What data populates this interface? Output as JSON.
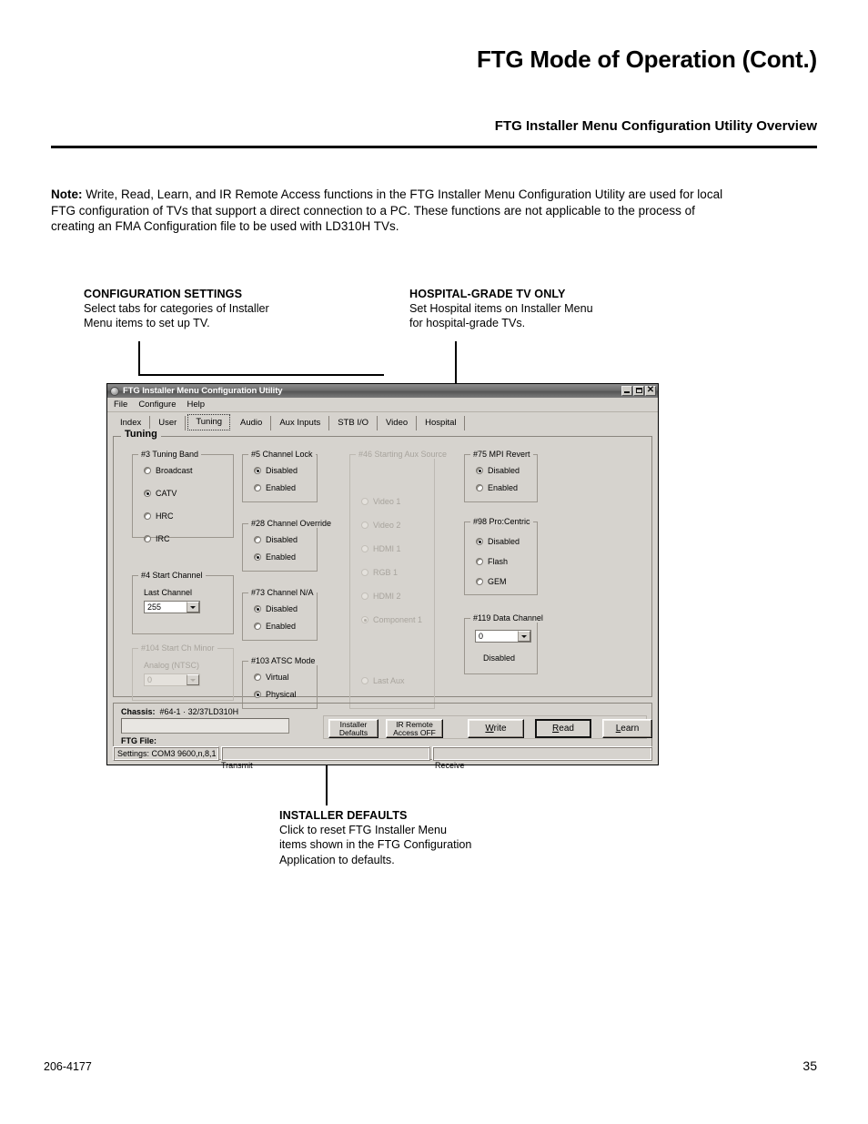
{
  "page": {
    "title": "FTG Mode of Operation (Cont.)",
    "subtitle": "FTG Installer Menu Configuration Utility Overview",
    "note_label": "Note:",
    "note_text": " Write, Read, Learn, and IR Remote Access functions in the FTG Installer Menu Configuration Utility are used for local FTG configuration of TVs that support a direct connection to a PC. These functions are not applicable to the process of creating an FMA Configuration file to be used with LD310H TVs.",
    "footer_left": "206-4177",
    "footer_right": "35"
  },
  "callouts": {
    "configuration": {
      "title": "CONFIGURATION SETTINGS",
      "line1": "Select tabs for categories of Installer",
      "line2": "Menu items to set up TV."
    },
    "hospital": {
      "title": "HOSPITAL-GRADE TV ONLY",
      "line1": "Set Hospital items on Installer Menu",
      "line2": "for hospital-grade TVs."
    },
    "installer_defaults": {
      "title": "INSTALLER DEFAULTS",
      "line1": "Click to reset FTG Installer Menu",
      "line2": "items shown in the FTG Configuration",
      "line3": "Application to defaults."
    }
  },
  "window": {
    "title": "FTG Installer Menu Configuration Utility",
    "controls": {
      "minimize": "_",
      "maximize": "□",
      "close": "✕"
    },
    "menu": [
      "File",
      "Configure",
      "Help"
    ],
    "tabs": [
      {
        "label": "Index",
        "selected": false
      },
      {
        "label": "User",
        "selected": false
      },
      {
        "label": "Tuning",
        "selected": true
      },
      {
        "label": "Audio",
        "selected": false
      },
      {
        "label": "Aux Inputs",
        "selected": false
      },
      {
        "label": "STB I/O",
        "selected": false
      },
      {
        "label": "Video",
        "selected": false
      },
      {
        "label": "Hospital",
        "selected": false
      }
    ],
    "panel_legend": "Tuning",
    "groups": {
      "tuning_band": {
        "legend": "#3 Tuning Band",
        "options": [
          "Broadcast",
          "CATV",
          "HRC",
          "IRC"
        ],
        "selected": "CATV"
      },
      "start_channel": {
        "legend": "#4 Start Channel",
        "field_label": "Last Channel",
        "value": "255"
      },
      "start_ch_minor": {
        "legend": "#104 Start Ch Minor",
        "field_label": "Analog (NTSC)",
        "value": "0",
        "disabled": true
      },
      "channel_lock": {
        "legend": "#5 Channel Lock",
        "options": [
          "Disabled",
          "Enabled"
        ],
        "selected": "Disabled"
      },
      "channel_override": {
        "legend": "#28 Channel Override",
        "options": [
          "Disabled",
          "Enabled"
        ],
        "selected": "Enabled"
      },
      "channel_na": {
        "legend": "#73 Channel N/A",
        "options": [
          "Disabled",
          "Enabled"
        ],
        "selected": "Disabled"
      },
      "atsc_mode": {
        "legend": "#103 ATSC Mode",
        "options": [
          "Virtual",
          "Physical"
        ],
        "selected": "Physical"
      },
      "starting_aux_source": {
        "legend": "#46 Starting Aux Source",
        "options": [
          "Video 1",
          "Video 2",
          "HDMI 1",
          "RGB 1",
          "HDMI 2",
          "Component 1",
          "Last Aux"
        ],
        "selected": "Component 1",
        "disabled": true
      },
      "mpi_revert": {
        "legend": "#75 MPI Revert",
        "options": [
          "Disabled",
          "Enabled"
        ],
        "selected": "Disabled"
      },
      "pro_centric": {
        "legend": "#98 Pro:Centric",
        "options": [
          "Disabled",
          "Flash",
          "GEM"
        ],
        "selected": "Disabled"
      },
      "data_channel": {
        "legend": "#119 Data Channel",
        "value": "0",
        "status": "Disabled"
      }
    },
    "bottom": {
      "chassis_label": "Chassis:",
      "chassis_value": "#64-1 · 32/37LD310H",
      "ftg_file_label": "FTG File:",
      "ftg_file_value": "",
      "buttons": [
        {
          "name": "installer-defaults",
          "line1": "Installer",
          "line2": "Defaults"
        },
        {
          "name": "ir-remote-access",
          "line1": "IR Remote",
          "line2": "Access OFF"
        },
        {
          "name": "write",
          "line1": "Write",
          "line2": ""
        },
        {
          "name": "read",
          "line1": "Read",
          "line2": ""
        },
        {
          "name": "learn",
          "line1": "Learn",
          "line2": ""
        }
      ],
      "status": {
        "settings": "Settings: COM3 9600,n,8,1",
        "transmit_value": "",
        "receive_value": "",
        "transmit_caption": "Transmit",
        "receive_caption": "Receive"
      }
    }
  }
}
